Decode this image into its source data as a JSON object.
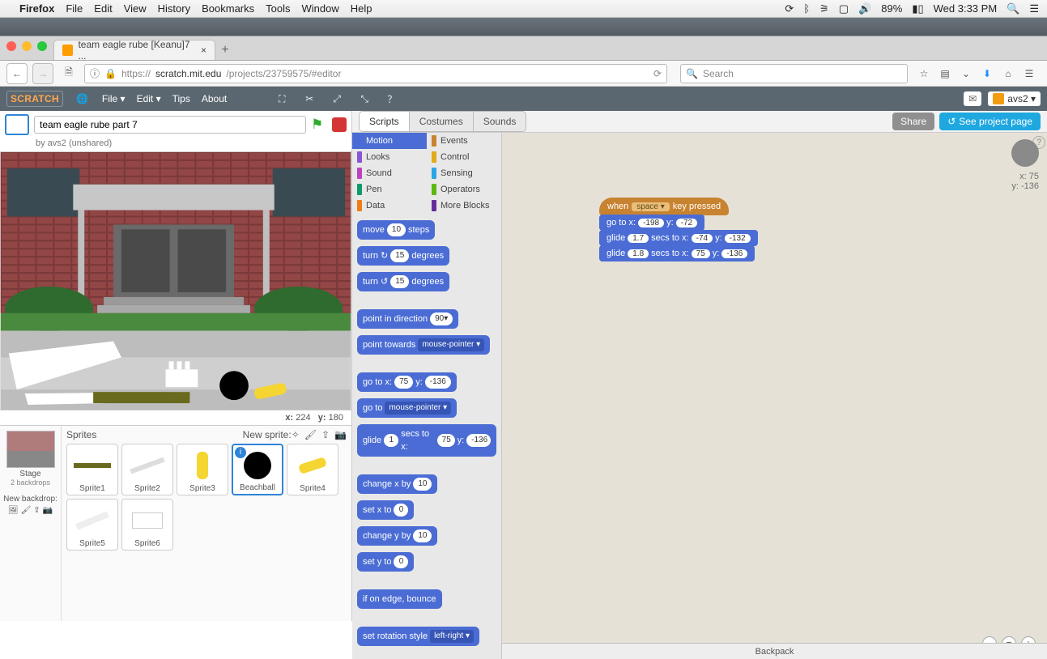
{
  "mac_menu": {
    "app": "Firefox",
    "items": [
      "File",
      "Edit",
      "View",
      "History",
      "Bookmarks",
      "Tools",
      "Window",
      "Help"
    ],
    "battery": "89%",
    "clock": "Wed 3:33 PM"
  },
  "browser": {
    "tab_title": "team eagle rube [Keanu]7 ...",
    "url_host": "scratch.mit.edu",
    "url_prefix": "https://",
    "url_path": "/projects/23759575/#editor",
    "search_placeholder": "Search"
  },
  "scratch_menu": {
    "items": [
      "File ▾",
      "Edit ▾",
      "Tips",
      "About"
    ],
    "username": "avs2 ▾"
  },
  "project": {
    "title": "team eagle rube part 7",
    "byline": "by avs2 (unshared)",
    "coords": {
      "x_label": "x:",
      "x": "224",
      "y_label": "y:",
      "y": "180"
    }
  },
  "stage_panel": {
    "label": "Stage",
    "backdrops": "2 backdrops",
    "new_backdrop": "New backdrop:"
  },
  "sprites": {
    "header": "Sprites",
    "new_sprite": "New sprite:",
    "list": [
      "Sprite1",
      "Sprite2",
      "Sprite3",
      "Beachball",
      "Sprite4",
      "Sprite5",
      "Sprite6"
    ],
    "selected": "Beachball"
  },
  "editor_tabs": [
    "Scripts",
    "Costumes",
    "Sounds"
  ],
  "top_buttons": {
    "share": "Share",
    "see": "See project page"
  },
  "categories": [
    {
      "name": "Motion",
      "color": "#4a6cd4",
      "active": true
    },
    {
      "name": "Events",
      "color": "#c88330"
    },
    {
      "name": "Looks",
      "color": "#8a55d7"
    },
    {
      "name": "Control",
      "color": "#e1a91a"
    },
    {
      "name": "Sound",
      "color": "#bb42c3"
    },
    {
      "name": "Sensing",
      "color": "#2ca5e2"
    },
    {
      "name": "Pen",
      "color": "#0e9a6c"
    },
    {
      "name": "Operators",
      "color": "#5cb712"
    },
    {
      "name": "Data",
      "color": "#ee7d16"
    },
    {
      "name": "More Blocks",
      "color": "#632d99"
    }
  ],
  "palette_blocks": [
    {
      "text": "move",
      "pills": [
        "10"
      ],
      "after": "steps"
    },
    {
      "text": "turn ↻",
      "pills": [
        "15"
      ],
      "after": "degrees"
    },
    {
      "text": "turn ↺",
      "pills": [
        "15"
      ],
      "after": "degrees"
    },
    {
      "gap": true
    },
    {
      "text": "point in direction",
      "pills": [
        "90▾"
      ]
    },
    {
      "text": "point towards",
      "drop": "mouse-pointer ▾"
    },
    {
      "gap": true
    },
    {
      "text": "go to x:",
      "pills": [
        "75"
      ],
      "mid": "y:",
      "pills2": [
        "-136"
      ]
    },
    {
      "text": "go to",
      "drop": "mouse-pointer ▾"
    },
    {
      "text": "glide",
      "pills": [
        "1"
      ],
      "mid": "secs to x:",
      "pills2": [
        "75"
      ],
      "mid2": "y:",
      "pills3": [
        "-136"
      ]
    },
    {
      "gap": true
    },
    {
      "text": "change x by",
      "pills": [
        "10"
      ]
    },
    {
      "text": "set x to",
      "pills": [
        "0"
      ]
    },
    {
      "text": "change y by",
      "pills": [
        "10"
      ]
    },
    {
      "text": "set y to",
      "pills": [
        "0"
      ]
    },
    {
      "gap": true
    },
    {
      "text": "if on edge, bounce"
    },
    {
      "gap": true
    },
    {
      "text": "set rotation style",
      "drop": "left-right ▾"
    }
  ],
  "script": {
    "hat": {
      "label": "when",
      "key": "space ▾",
      "after": "key pressed"
    },
    "blocks": [
      {
        "t": "go to x:",
        "p1": "-198",
        "m": "y:",
        "p2": "-72"
      },
      {
        "t": "glide",
        "p1": "1.7",
        "m": "secs to x:",
        "p2": "-74",
        "m2": "y:",
        "p3": "-132"
      },
      {
        "t": "glide",
        "p1": "1.8",
        "m": "secs to x:",
        "p2": "75",
        "m2": "y:",
        "p3": "-136"
      }
    ]
  },
  "canvas_info": {
    "x_label": "x: ",
    "x": "75",
    "y_label": "y: ",
    "y": "-136"
  },
  "backpack": "Backpack"
}
